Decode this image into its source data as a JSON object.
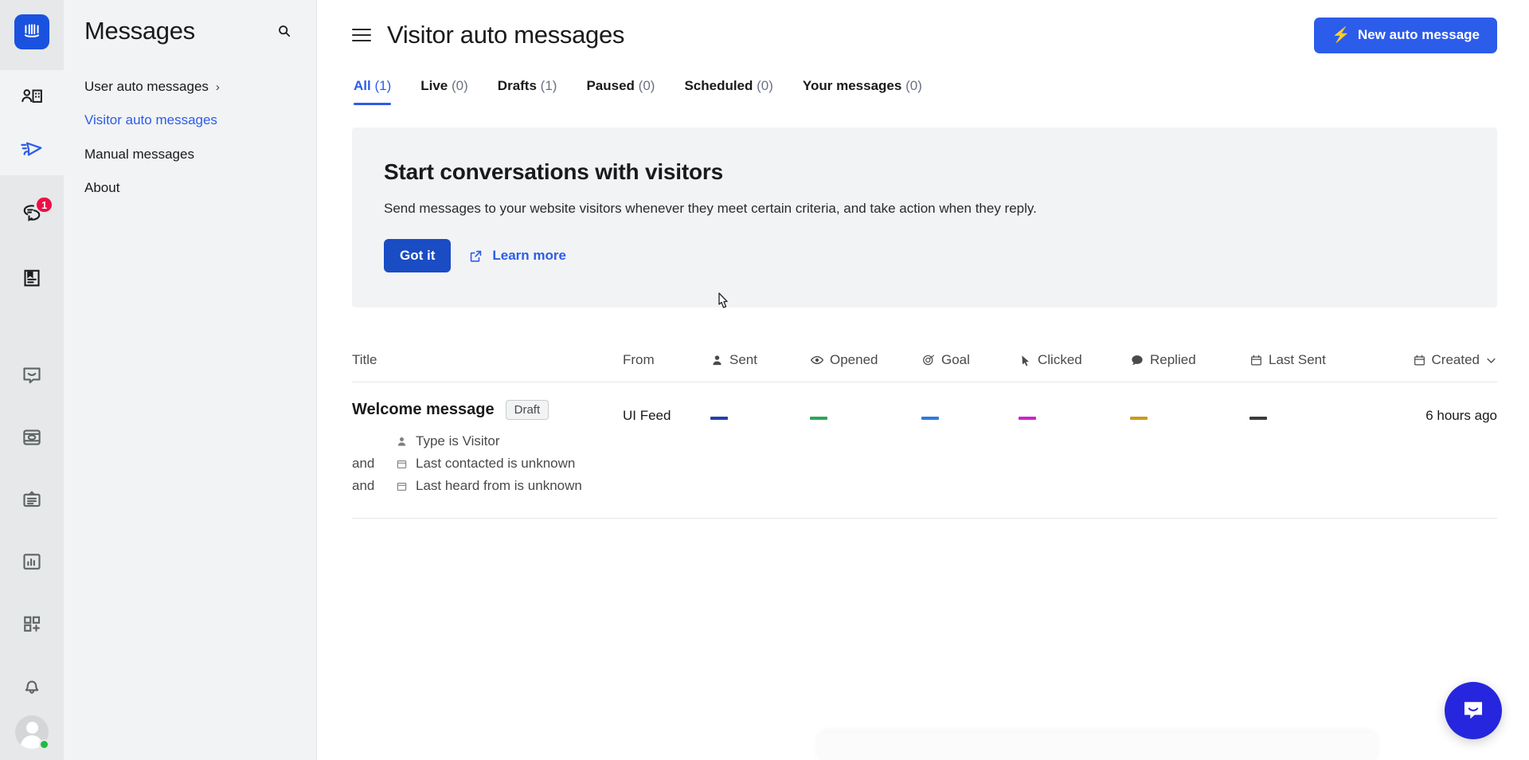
{
  "rail": {
    "logo_icon": "intercom-logo-icon",
    "items": [
      {
        "icon": "contacts-icon",
        "name": "contacts",
        "selected": true,
        "badge": null
      },
      {
        "icon": "outbound-send-icon",
        "name": "messages",
        "selected": true,
        "badge": null
      },
      {
        "icon": "inbox-conversations-icon",
        "name": "inbox",
        "selected": false,
        "badge": "1"
      },
      {
        "icon": "articles-icon",
        "name": "articles",
        "selected": false,
        "badge": null
      },
      {
        "icon": "messenger-icon",
        "name": "messenger",
        "selected": false,
        "badge": null
      },
      {
        "icon": "product-tours-icon",
        "name": "tours",
        "selected": false,
        "badge": null
      },
      {
        "icon": "surveys-clipboard-icon",
        "name": "surveys",
        "selected": false,
        "badge": null
      },
      {
        "icon": "reports-bar-chart-icon",
        "name": "reports",
        "selected": false,
        "badge": null
      },
      {
        "icon": "apps-grid-plus-icon",
        "name": "apps",
        "selected": false,
        "badge": null
      },
      {
        "icon": "bell-notifications-icon",
        "name": "notifications",
        "selected": false,
        "badge": null
      }
    ],
    "avatar": {
      "icon": "avatar",
      "status": "online",
      "status_color": "#20ba43"
    },
    "badge_color": "#ed0e48"
  },
  "sidebar": {
    "title": "Messages",
    "search_icon": "search-icon",
    "items": [
      {
        "label": "User auto messages",
        "active": false,
        "has_chevron": true
      },
      {
        "label": "Visitor auto messages",
        "active": true,
        "has_chevron": false
      },
      {
        "label": "Manual messages",
        "active": false,
        "has_chevron": false
      },
      {
        "label": "About",
        "active": false,
        "has_chevron": false
      }
    ],
    "chevron_glyph": "›"
  },
  "header": {
    "menu_icon": "hamburger-menu-icon",
    "title": "Visitor auto messages",
    "new_button_label": "New auto message",
    "new_button_icon": "lightning-bolt-icon",
    "accent_color": "#2c5cea"
  },
  "tabs": [
    {
      "label": "All",
      "count": "(1)",
      "active": true
    },
    {
      "label": "Live",
      "count": "(0)",
      "active": false
    },
    {
      "label": "Drafts",
      "count": "(1)",
      "active": false
    },
    {
      "label": "Paused",
      "count": "(0)",
      "active": false
    },
    {
      "label": "Scheduled",
      "count": "(0)",
      "active": false
    },
    {
      "label": "Your messages",
      "count": "(0)",
      "active": false
    }
  ],
  "banner": {
    "heading": "Start conversations with visitors",
    "body": "Send messages to your website visitors whenever they meet certain criteria, and take action when they reply.",
    "primary_label": "Got it",
    "link_label": "Learn more",
    "link_icon": "external-link-icon"
  },
  "table": {
    "columns": [
      {
        "label": "Title",
        "icon": null
      },
      {
        "label": "From",
        "icon": null
      },
      {
        "label": "Sent",
        "icon": "person-icon"
      },
      {
        "label": "Opened",
        "icon": "eye-icon"
      },
      {
        "label": "Goal",
        "icon": "target-goal-icon"
      },
      {
        "label": "Clicked",
        "icon": "cursor-arrow-icon"
      },
      {
        "label": "Replied",
        "icon": "speech-bubble-icon"
      },
      {
        "label": "Last Sent",
        "icon": "calendar-icon"
      },
      {
        "label": "Created",
        "icon": "calendar-icon",
        "sort_icon": "chevron-down-icon",
        "sorted": true
      }
    ],
    "rows": [
      {
        "title": "Welcome message",
        "badge": "Draft",
        "rules": [
          {
            "prefix": "",
            "icon": "person-icon",
            "text": "Type is Visitor"
          },
          {
            "prefix": "and",
            "icon": "calendar-icon",
            "text": "Last contacted is unknown"
          },
          {
            "prefix": "and",
            "icon": "calendar-icon",
            "text": "Last heard from is unknown"
          }
        ],
        "from": "UI Feed",
        "sent": "—",
        "sent_color": "#2340ad",
        "opened": "—",
        "opened_color": "#2aa859",
        "goal": "—",
        "goal_color": "#2f7bdd",
        "clicked": "—",
        "clicked_color": "#cc24cc",
        "replied": "—",
        "replied_color": "#cc9a1c",
        "last_sent": "—",
        "last_sent_color": "#3b3b3b",
        "created": "6 hours ago"
      }
    ]
  },
  "launcher": {
    "icon": "messenger-launcher-icon",
    "color": "#2626df"
  }
}
